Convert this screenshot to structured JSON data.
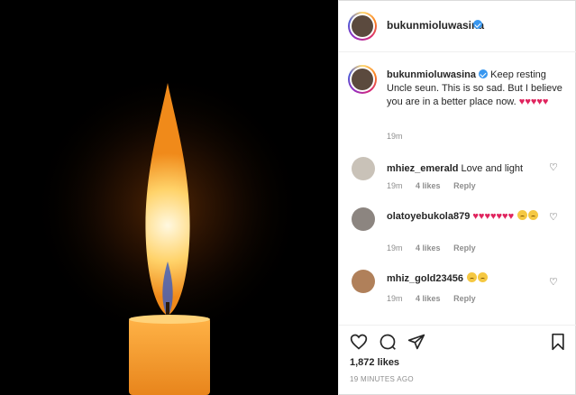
{
  "post": {
    "username": "bukunmioluwasina",
    "caption_user": "bukunmioluwasina",
    "caption_text": "Keep resting Uncle seun. This is so sad. But I believe you are in a better place now.",
    "caption_time": "19m",
    "likes": "1,872 likes",
    "time_ago": "19 MINUTES AGO"
  },
  "comments": [
    {
      "user": "mhiez_emerald",
      "text": "Love and light",
      "time": "19m",
      "likes": "4 likes",
      "reply": "Reply"
    },
    {
      "user": "olatoyebukola879",
      "text": "",
      "time": "19m",
      "likes": "4 likes",
      "reply": "Reply"
    },
    {
      "user": "mhiz_gold23456",
      "text": "",
      "time": "19m",
      "likes": "4 likes",
      "reply": "Reply"
    }
  ],
  "colors": {
    "verified": "#3897f0",
    "heart": "#e0245e",
    "muted": "#8e8e8e"
  }
}
